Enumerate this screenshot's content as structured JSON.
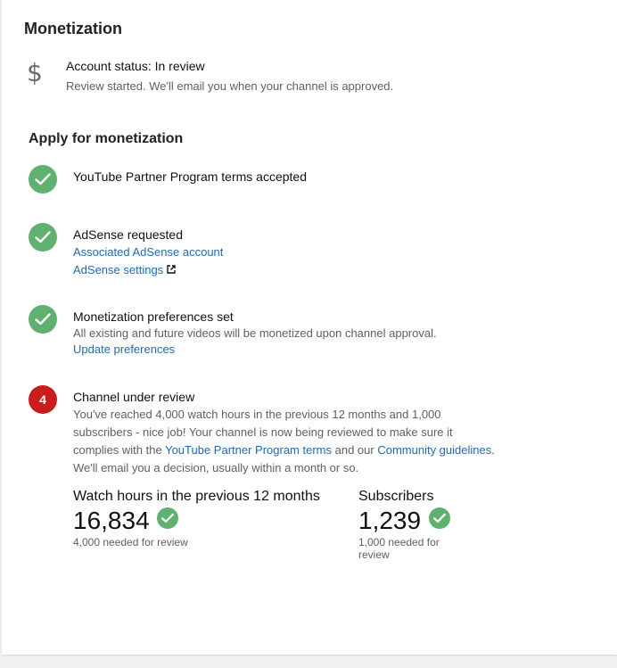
{
  "page": {
    "title": "Monetization"
  },
  "account_status": {
    "icon": "dollar-icon",
    "title": "Account status: In review",
    "subtitle": "Review started. We'll email you when your channel is approved."
  },
  "apply": {
    "title": "Apply for monetization",
    "steps": [
      {
        "state": "complete",
        "icon": "check-circle-icon",
        "title": "YouTube Partner Program terms accepted"
      },
      {
        "state": "complete",
        "icon": "check-circle-icon",
        "title": "AdSense requested",
        "links": [
          "Associated AdSense account",
          "AdSense settings"
        ]
      },
      {
        "state": "complete",
        "icon": "check-circle-icon",
        "title": "Monetization preferences set",
        "text": "All existing and future videos will be monetized upon channel approval.",
        "links": [
          "Update preferences"
        ]
      },
      {
        "state": "in-progress",
        "number": "4",
        "title": "Channel under review",
        "text_part1": "You've reached 4,000 watch hours in the previous 12 months and 1,000",
        "text_part2": "subscribers - nice job! Your channel is now being reviewed to make sure it",
        "text_part3_a": "complies with the ",
        "link_terms": "YouTube Partner Program terms",
        "text_part3_b": " and our ",
        "link_guidelines": "Community guidelines",
        "text_part3_c": ".",
        "text_part4": "We'll email you a decision, usually within a month or so."
      }
    ]
  },
  "stats": {
    "watch_hours": {
      "label": "Watch hours in the previous 12 months",
      "value": "16,834",
      "note": "4,000 needed for review"
    },
    "subscribers": {
      "label": "Subscribers",
      "value": "1,239",
      "note": "1,000 needed for review"
    }
  },
  "colors": {
    "success": "#5fb16f",
    "pending": "#cc1b1b",
    "link": "#1e6ab8",
    "secondary_text": "#606060"
  }
}
